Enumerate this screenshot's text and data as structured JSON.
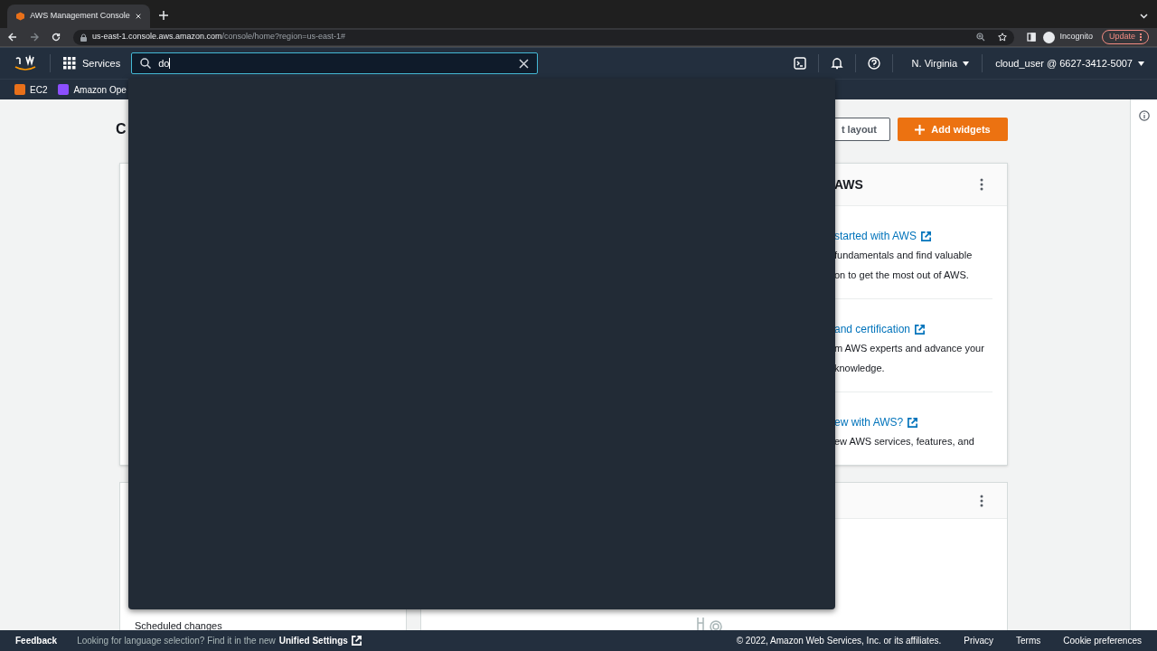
{
  "browser": {
    "tab_title": "AWS Management Console",
    "url_host": "us-east-1.console.aws.amazon.com",
    "url_path": "/console/home?region=us-east-1#",
    "profile": "Incognito",
    "update_button": "Update"
  },
  "nav": {
    "services": "Services",
    "search": {
      "value": "do"
    },
    "region": "N. Virginia",
    "account": "cloud_user @ 6627-3412-5007"
  },
  "favorites": [
    {
      "label": "EC2",
      "color": "#e8701a"
    },
    {
      "label": "Amazon Ope",
      "color": "#8c4fff"
    }
  ],
  "page": {
    "title": "C",
    "reset_button": "t layout",
    "add_button": "Add widgets"
  },
  "welcome_widget": {
    "title": "AWS",
    "items": [
      {
        "link": "started with AWS",
        "lines": [
          "fundamentals and find valuable",
          "on to get the most out of AWS."
        ]
      },
      {
        "link": "and certification",
        "lines": [
          "m AWS experts and advance your",
          "knowledge."
        ]
      },
      {
        "link": "ew with AWS?",
        "lines": [
          "ew AWS services, features, and"
        ]
      }
    ]
  },
  "scheduled_widget": {
    "label": "Scheduled changes"
  },
  "footer": {
    "feedback": "Feedback",
    "language_note": "Looking for language selection? Find it in the new",
    "settings_link": "Unified Settings",
    "copyright": "© 2022, Amazon Web Services, Inc. or its affiliates.",
    "links": [
      "Privacy",
      "Terms",
      "Cookie preferences"
    ]
  }
}
